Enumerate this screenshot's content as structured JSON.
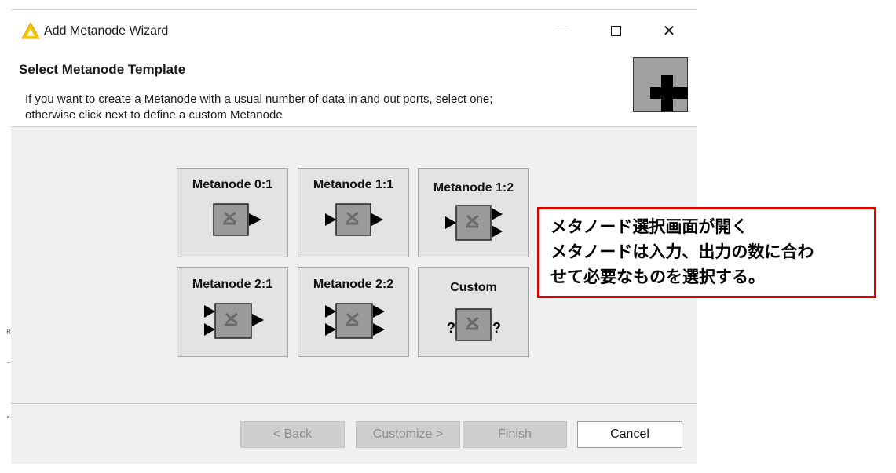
{
  "window": {
    "title": "Add Metanode Wizard"
  },
  "header": {
    "title": "Select Metanode Template",
    "description_line1": "If you want to create a Metanode with a usual number of data in and out ports, select one;",
    "description_line2": "otherwise click next to define a custom Metanode",
    "icon": "add-metanode-icon"
  },
  "templates": [
    {
      "label": "Metanode 0:1",
      "inputs": 0,
      "outputs": 1
    },
    {
      "label": "Metanode 1:1",
      "inputs": 1,
      "outputs": 1
    },
    {
      "label": "Metanode 1:2",
      "inputs": 1,
      "outputs": 2
    },
    {
      "label": "Metanode 2:1",
      "inputs": 2,
      "outputs": 1
    },
    {
      "label": "Metanode 2:2",
      "inputs": 2,
      "outputs": 2
    },
    {
      "label": "Custom",
      "inputs": "?",
      "outputs": "?"
    }
  ],
  "buttons": {
    "back": "< Back",
    "customize": "Customize >",
    "finish": "Finish",
    "cancel": "Cancel"
  },
  "annotation": {
    "line1": "メタノード選択画面が開く",
    "line2": "メタノードは入力、出力の数に合わ",
    "line3": "せて必要なものを選択する。",
    "border_color": "#e00000"
  },
  "colors": {
    "node_fill": "#9a9a9a",
    "tile_bg": "#e3e3e3",
    "warning_yellow": "#f5c400"
  }
}
